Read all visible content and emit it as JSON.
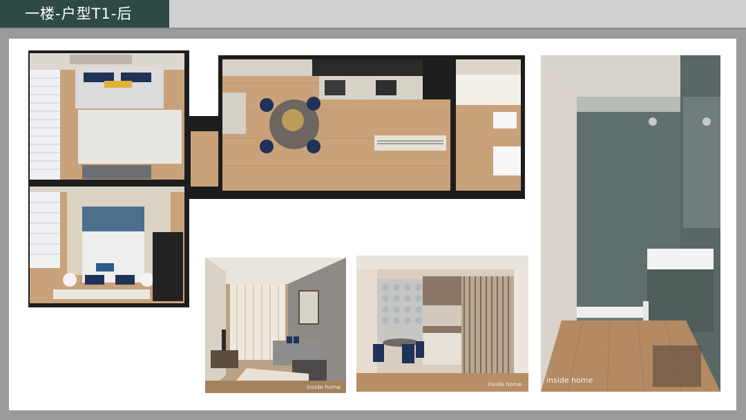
{
  "header": {
    "title": "一楼-户型T1-后"
  },
  "images": {
    "floor_plan": {
      "name": "floor-plan-render"
    },
    "living_room": {
      "name": "living-room-render",
      "watermark": "inside home"
    },
    "dining_kitchen": {
      "name": "dining-kitchen-render",
      "watermark": "inside home"
    },
    "bathroom": {
      "name": "bathroom-render",
      "watermark": "inside home"
    }
  },
  "colors": {
    "title_bg": "#2d4a47",
    "slide_bg": "#9a9b9c",
    "wood": "#c79f77",
    "navy": "#1f3257",
    "slate_blue": "#4d6f8e",
    "tile_green": "#5f6f6d"
  }
}
